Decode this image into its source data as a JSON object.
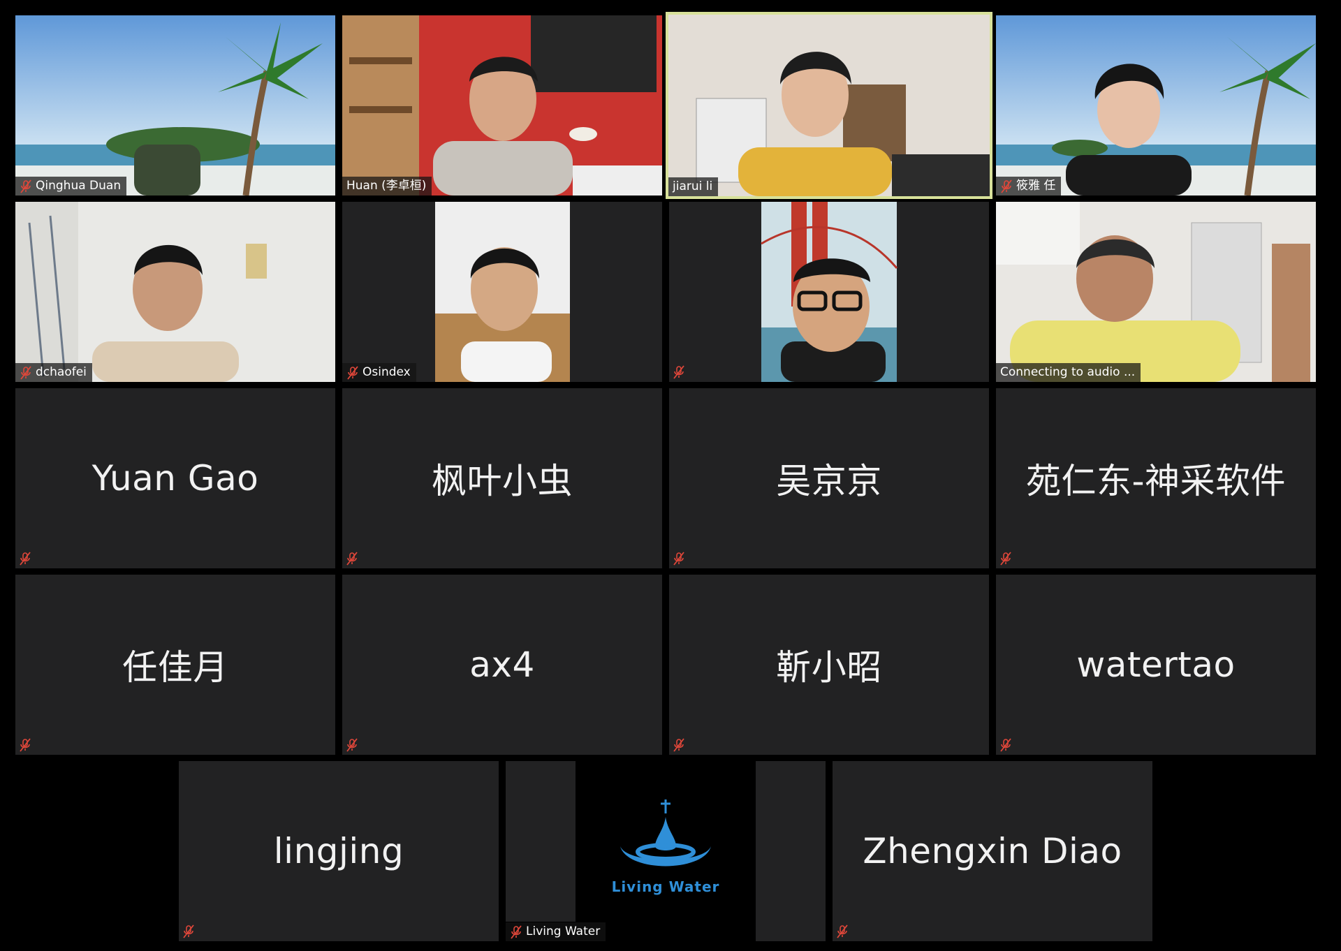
{
  "participants": [
    {
      "name": "Qinghua Duan",
      "muted": true,
      "video": true
    },
    {
      "name": "Huan (李卓桓)",
      "muted": false,
      "video": true
    },
    {
      "name": "jiarui li",
      "muted": false,
      "video": true,
      "speaking": true
    },
    {
      "name": "筱雅 任",
      "muted": true,
      "video": true
    },
    {
      "name": "dchaofei",
      "muted": true,
      "video": true
    },
    {
      "name": "Osindex",
      "muted": true,
      "video": true
    },
    {
      "name": "",
      "muted": true,
      "video": true
    },
    {
      "name": "Connecting to audio ...",
      "muted": false,
      "video": true
    },
    {
      "name": "Yuan Gao",
      "muted": true,
      "video": false
    },
    {
      "name": "枫叶小虫",
      "muted": true,
      "video": false
    },
    {
      "name": "吴京京",
      "muted": true,
      "video": false
    },
    {
      "name": "苑仁东-神采软件",
      "muted": true,
      "video": false
    },
    {
      "name": "任佳月",
      "muted": true,
      "video": false
    },
    {
      "name": "ax4",
      "muted": true,
      "video": false
    },
    {
      "name": "靳小昭",
      "muted": true,
      "video": false
    },
    {
      "name": "watertao",
      "muted": true,
      "video": false
    },
    {
      "name": "lingjing",
      "muted": true,
      "video": false
    },
    {
      "name": "Living Water",
      "muted": true,
      "video": true
    },
    {
      "name": "Zhengxin Diao",
      "muted": true,
      "video": false
    }
  ],
  "logo": {
    "text": "Living Water",
    "color": "#2f8fd8"
  },
  "colors": {
    "speaking_border": "#d8e19a",
    "tile_bg": "#222223",
    "mute_red": "#e0473a"
  }
}
